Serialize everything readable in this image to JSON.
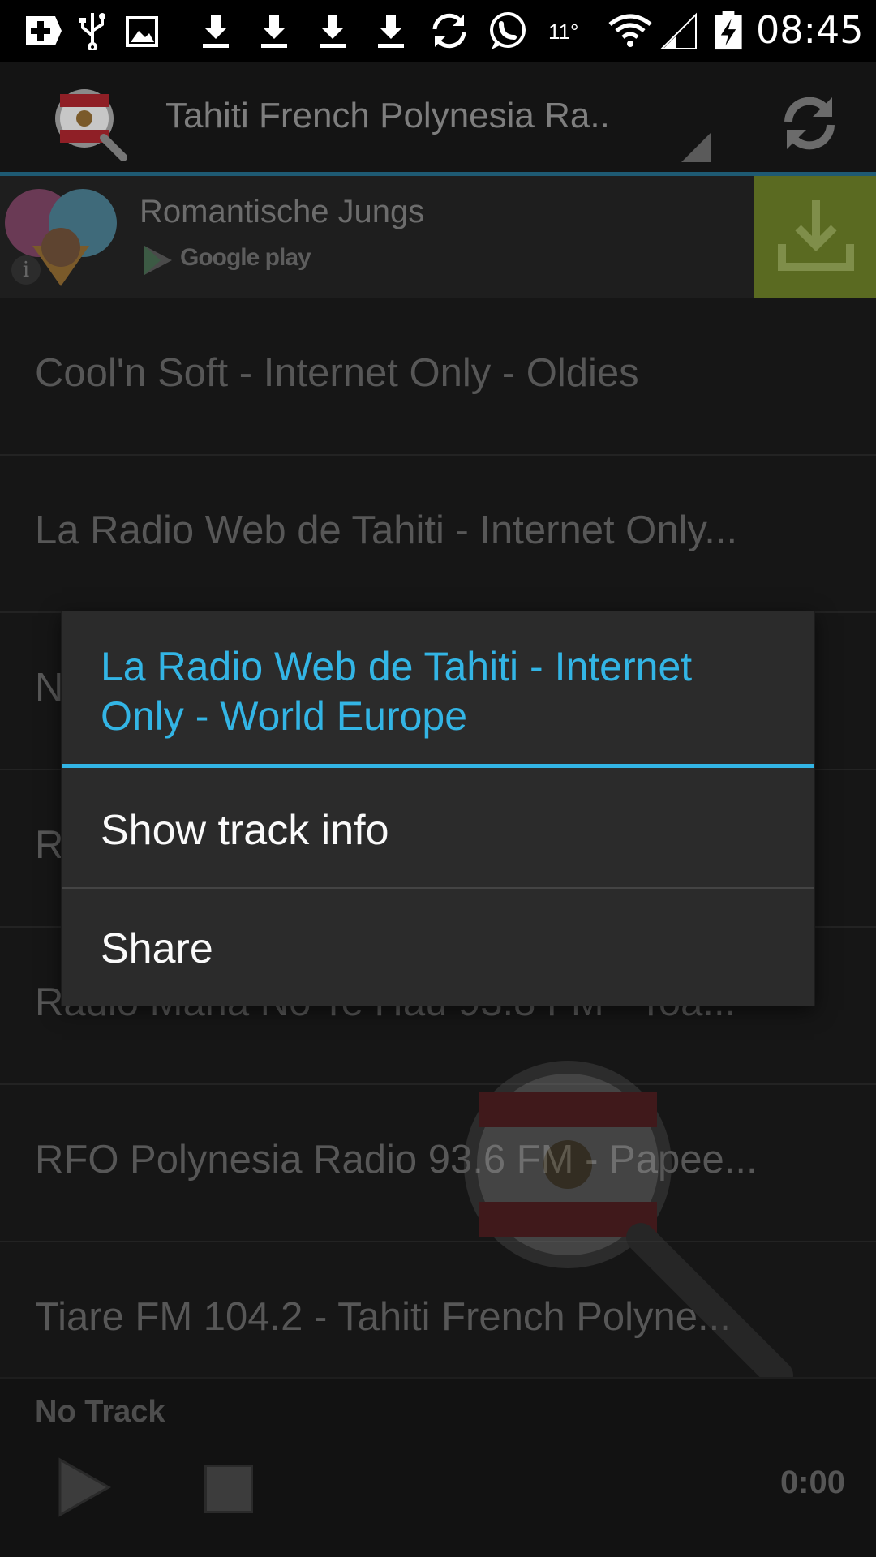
{
  "status_bar": {
    "temperature": "11°",
    "time": "08:45",
    "icons": [
      "add-icon",
      "usb-icon",
      "image-icon",
      "download-icon",
      "download-icon",
      "download-icon",
      "download-icon",
      "sync-icon",
      "whatsapp-icon",
      "wifi-icon",
      "signal-icon",
      "battery-charging-icon"
    ]
  },
  "action_bar": {
    "title": "Tahiti French Polynesia Ra..",
    "logo_icon": "app-logo-flag-magnifier",
    "refresh_icon": "refresh-icon"
  },
  "ad": {
    "title": "Romantische Jungs",
    "store_label": "Google play",
    "info_glyph": "i",
    "download_icon": "download-icon"
  },
  "stations": [
    {
      "label": "Cool'n Soft - Internet Only - Oldies"
    },
    {
      "label": "La Radio Web de Tahiti - Internet Only..."
    },
    {
      "label": "N"
    },
    {
      "label": "R"
    },
    {
      "label": "Radio Maria No Te Hau 93.8 FM - Toa..."
    },
    {
      "label": "RFO Polynesia Radio 93.6 FM - Papee..."
    },
    {
      "label": "Tiare FM 104.2 - Tahiti French Polyne..."
    }
  ],
  "player": {
    "track": "No Track",
    "time": "0:00"
  },
  "dialog": {
    "title": "La Radio Web de Tahiti - Internet Only - World Europe",
    "items": [
      {
        "label": "Show track info"
      },
      {
        "label": "Share"
      }
    ]
  },
  "colors": {
    "accent": "#33b5e5",
    "ad_download_bg": "#5a6a21"
  }
}
